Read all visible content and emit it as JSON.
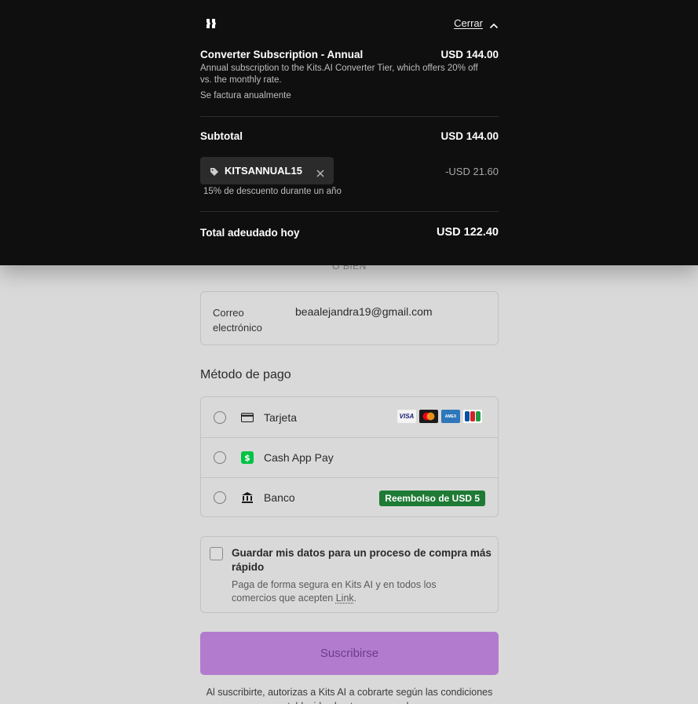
{
  "summary": {
    "close_label": "Cerrar",
    "product": {
      "name": "Converter Subscription - Annual",
      "price": "USD 144.00",
      "description": "Annual subscription to the Kits.AI Converter Tier, which offers 20% off vs. the monthly rate.",
      "billing": "Se factura anualmente"
    },
    "subtotal_label": "Subtotal",
    "subtotal_value": "USD 144.00",
    "promo": {
      "code": "KITSANNUAL15",
      "discount": "-USD 21.60",
      "note": "15% de descuento durante un año"
    },
    "total_label": "Total adeudado hoy",
    "total_value": "USD 122.40"
  },
  "form": {
    "or_text": "O BIEN",
    "email_label": "Correo electrónico",
    "email_value": "beaalejandra19@gmail.com",
    "payment_title": "Método de pago",
    "payment_methods": [
      {
        "label": "Tarjeta",
        "icon": "card-icon"
      },
      {
        "label": "Cash App Pay",
        "icon": "cash-app-icon"
      },
      {
        "label": "Banco",
        "icon": "bank-icon"
      }
    ],
    "card_brands": [
      "VISA",
      "Mastercard",
      "AMERICAN EXPRESS",
      "JCB"
    ],
    "bank_badge": "Reembolso de USD 5",
    "save": {
      "title": "Guardar mis datos para un proceso de compra más rápido",
      "desc_pre": "Paga de forma segura en Kits AI y en todos los comercios que acepten ",
      "desc_link": "Link",
      "desc_post": "."
    },
    "subscribe_label": "Suscribirse",
    "legal": "Al suscribirte, autorizas a Kits AI a cobrarte según las condiciones establecidas hasta que canceles."
  },
  "colors": {
    "panel_bg": "#0f0f0f",
    "page_bg": "#d9d9d9",
    "subscribe_bg": "#b27bcd",
    "badge_green": "#1e7a34"
  }
}
